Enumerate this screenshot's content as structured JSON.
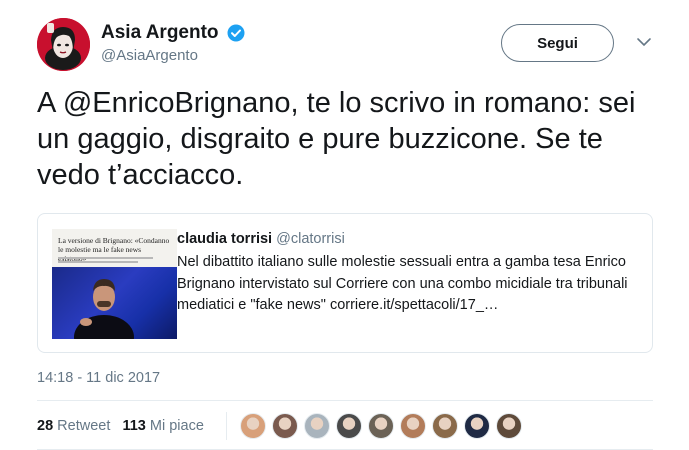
{
  "author": {
    "name": "Asia Argento",
    "handle": "@AsiaArgento",
    "verified": true,
    "avatar_icon": "asia-argento-avatar",
    "verified_icon": "verified-badge-icon"
  },
  "follow_button": {
    "label": "Segui"
  },
  "menu": {
    "icon": "chevron-down-icon"
  },
  "tweet": {
    "text_before": "A ",
    "mention": "@EnricoBrignano",
    "text_after": ", te lo scrivo in romano: sei un gaggio, disgraito e pure buzzicone. Se te vedo t’acciacco."
  },
  "quoted_tweet": {
    "author_name": "claudia torrisi",
    "author_handle": "@clatorrisi",
    "text": "Nel dibattito italiano sulle molestie sessuali entra a gamba tesa Enrico Brignano intervistato sul Corriere con una combo micidiale tra tribunali mediatici e \"fake news\" corriere.it/spettacoli/17_…",
    "thumbnail_headline": "La versione di Brignano: «Condanno le molestie ma le fake news esistono»"
  },
  "timestamp": "14:18 - 11 dic 2017",
  "stats": {
    "retweets_count": "28",
    "retweets_label": "Retweet",
    "likes_count": "113",
    "likes_label": "Mi piace"
  },
  "likers": [
    {
      "color": "#d8a07a"
    },
    {
      "color": "#7a5a4e"
    },
    {
      "color": "#a9b4bd"
    },
    {
      "color": "#4a4a4a"
    },
    {
      "color": "#6b6256"
    },
    {
      "color": "#b27c5a"
    },
    {
      "color": "#8a6a4a"
    },
    {
      "color": "#1f2a44"
    },
    {
      "color": "#5e4a3a"
    }
  ],
  "colors": {
    "text": "#14171a",
    "secondary": "#657786",
    "verified_blue": "#1da1f2",
    "border": "#e1e8ed",
    "avatar_red": "#c8102e"
  }
}
